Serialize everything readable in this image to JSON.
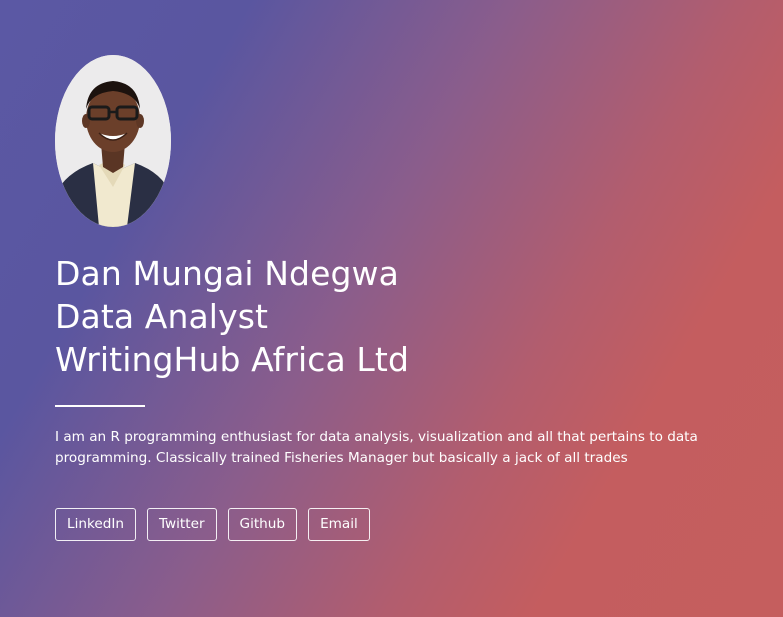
{
  "profile": {
    "name": "Dan Mungai Ndegwa",
    "role": "Data Analyst",
    "organization": "WritingHub Africa Ltd",
    "bio": "I am an R programming enthusiast for data analysis, visualization and all that pertains to data programming. Classically trained Fisheries Manager but basically a jack of all trades",
    "avatar_alt": "Profile photo"
  },
  "links": [
    {
      "label": "LinkedIn"
    },
    {
      "label": "Twitter"
    },
    {
      "label": "Github"
    },
    {
      "label": "Email"
    }
  ],
  "colors": {
    "gradient_start": "#5b58a4",
    "gradient_end": "#c55e5e",
    "text": "#ffffff"
  }
}
